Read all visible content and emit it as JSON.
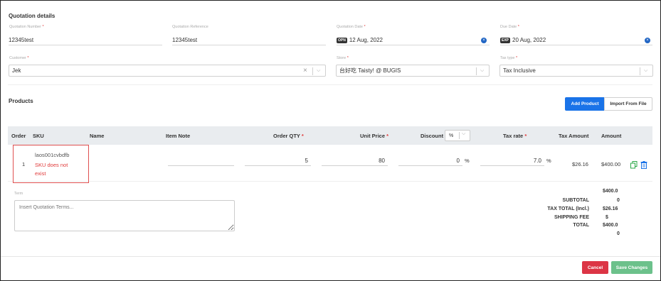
{
  "quotation": {
    "section_title": "Quotation details",
    "number_label": "Quotation Number",
    "number_value": "12345test",
    "reference_label": "Quotation Reference",
    "reference_value": "12345test",
    "date_label": "Quotation Date",
    "date_badge": "OPN",
    "date_value": "12 Aug, 2022",
    "due_label": "Due Date",
    "due_badge": "EXP",
    "due_value": "20 Aug, 2022",
    "customer_label": "Customer",
    "customer_value": "Jek",
    "store_label": "Store",
    "store_value": "台好吃 Taisty! @ BUGIS",
    "tax_type_label": "Tax type",
    "tax_type_value": "Tax Inclusive",
    "required_mark": "*",
    "clear_glyph": "×",
    "caret_glyph": "⌵"
  },
  "products": {
    "section_title": "Products",
    "add_product_label": "Add Product",
    "import_label": "Import From File",
    "columns": {
      "order": "Order",
      "sku": "SKU",
      "name": "Name",
      "item_note": "Item Note",
      "order_qty": "Order QTY",
      "unit_price": "Unit Price",
      "discount": "Discount",
      "discount_unit": "%",
      "tax_rate": "Tax rate",
      "tax_amount": "Tax Amount",
      "amount": "Amount"
    },
    "row": {
      "order": "1",
      "sku": "laos001cvbdfb",
      "sku_error_line1": "SKU does not",
      "sku_error_line2": "exist",
      "qty": "5",
      "unit_price": "80",
      "discount": "0",
      "discount_unit": "%",
      "tax_rate": "7.0",
      "tax_rate_unit": "%",
      "tax_amount": "$26.16",
      "amount": "$400.00"
    }
  },
  "terms": {
    "label": "Term",
    "placeholder": "Insert Quotation Terms..."
  },
  "totals": {
    "top_value": "$400.0",
    "subtotal_label": "SUBTOTAL",
    "subtotal_value": "0",
    "tax_total_label": "TAX TOTAL (Incl.)",
    "tax_total_value": "$26.16",
    "shipping_label": "SHIPPING FEE",
    "shipping_value": "$",
    "total_label": "TOTAL",
    "total_value": "$400.0",
    "bottom_value": "0"
  },
  "footer": {
    "cancel_label": "Cancel",
    "save_label": "Save Changes"
  },
  "colors": {
    "primary": "#1a73e8",
    "danger": "#dc3545",
    "success": "#6cc18b",
    "error_text": "#e03a3a"
  }
}
